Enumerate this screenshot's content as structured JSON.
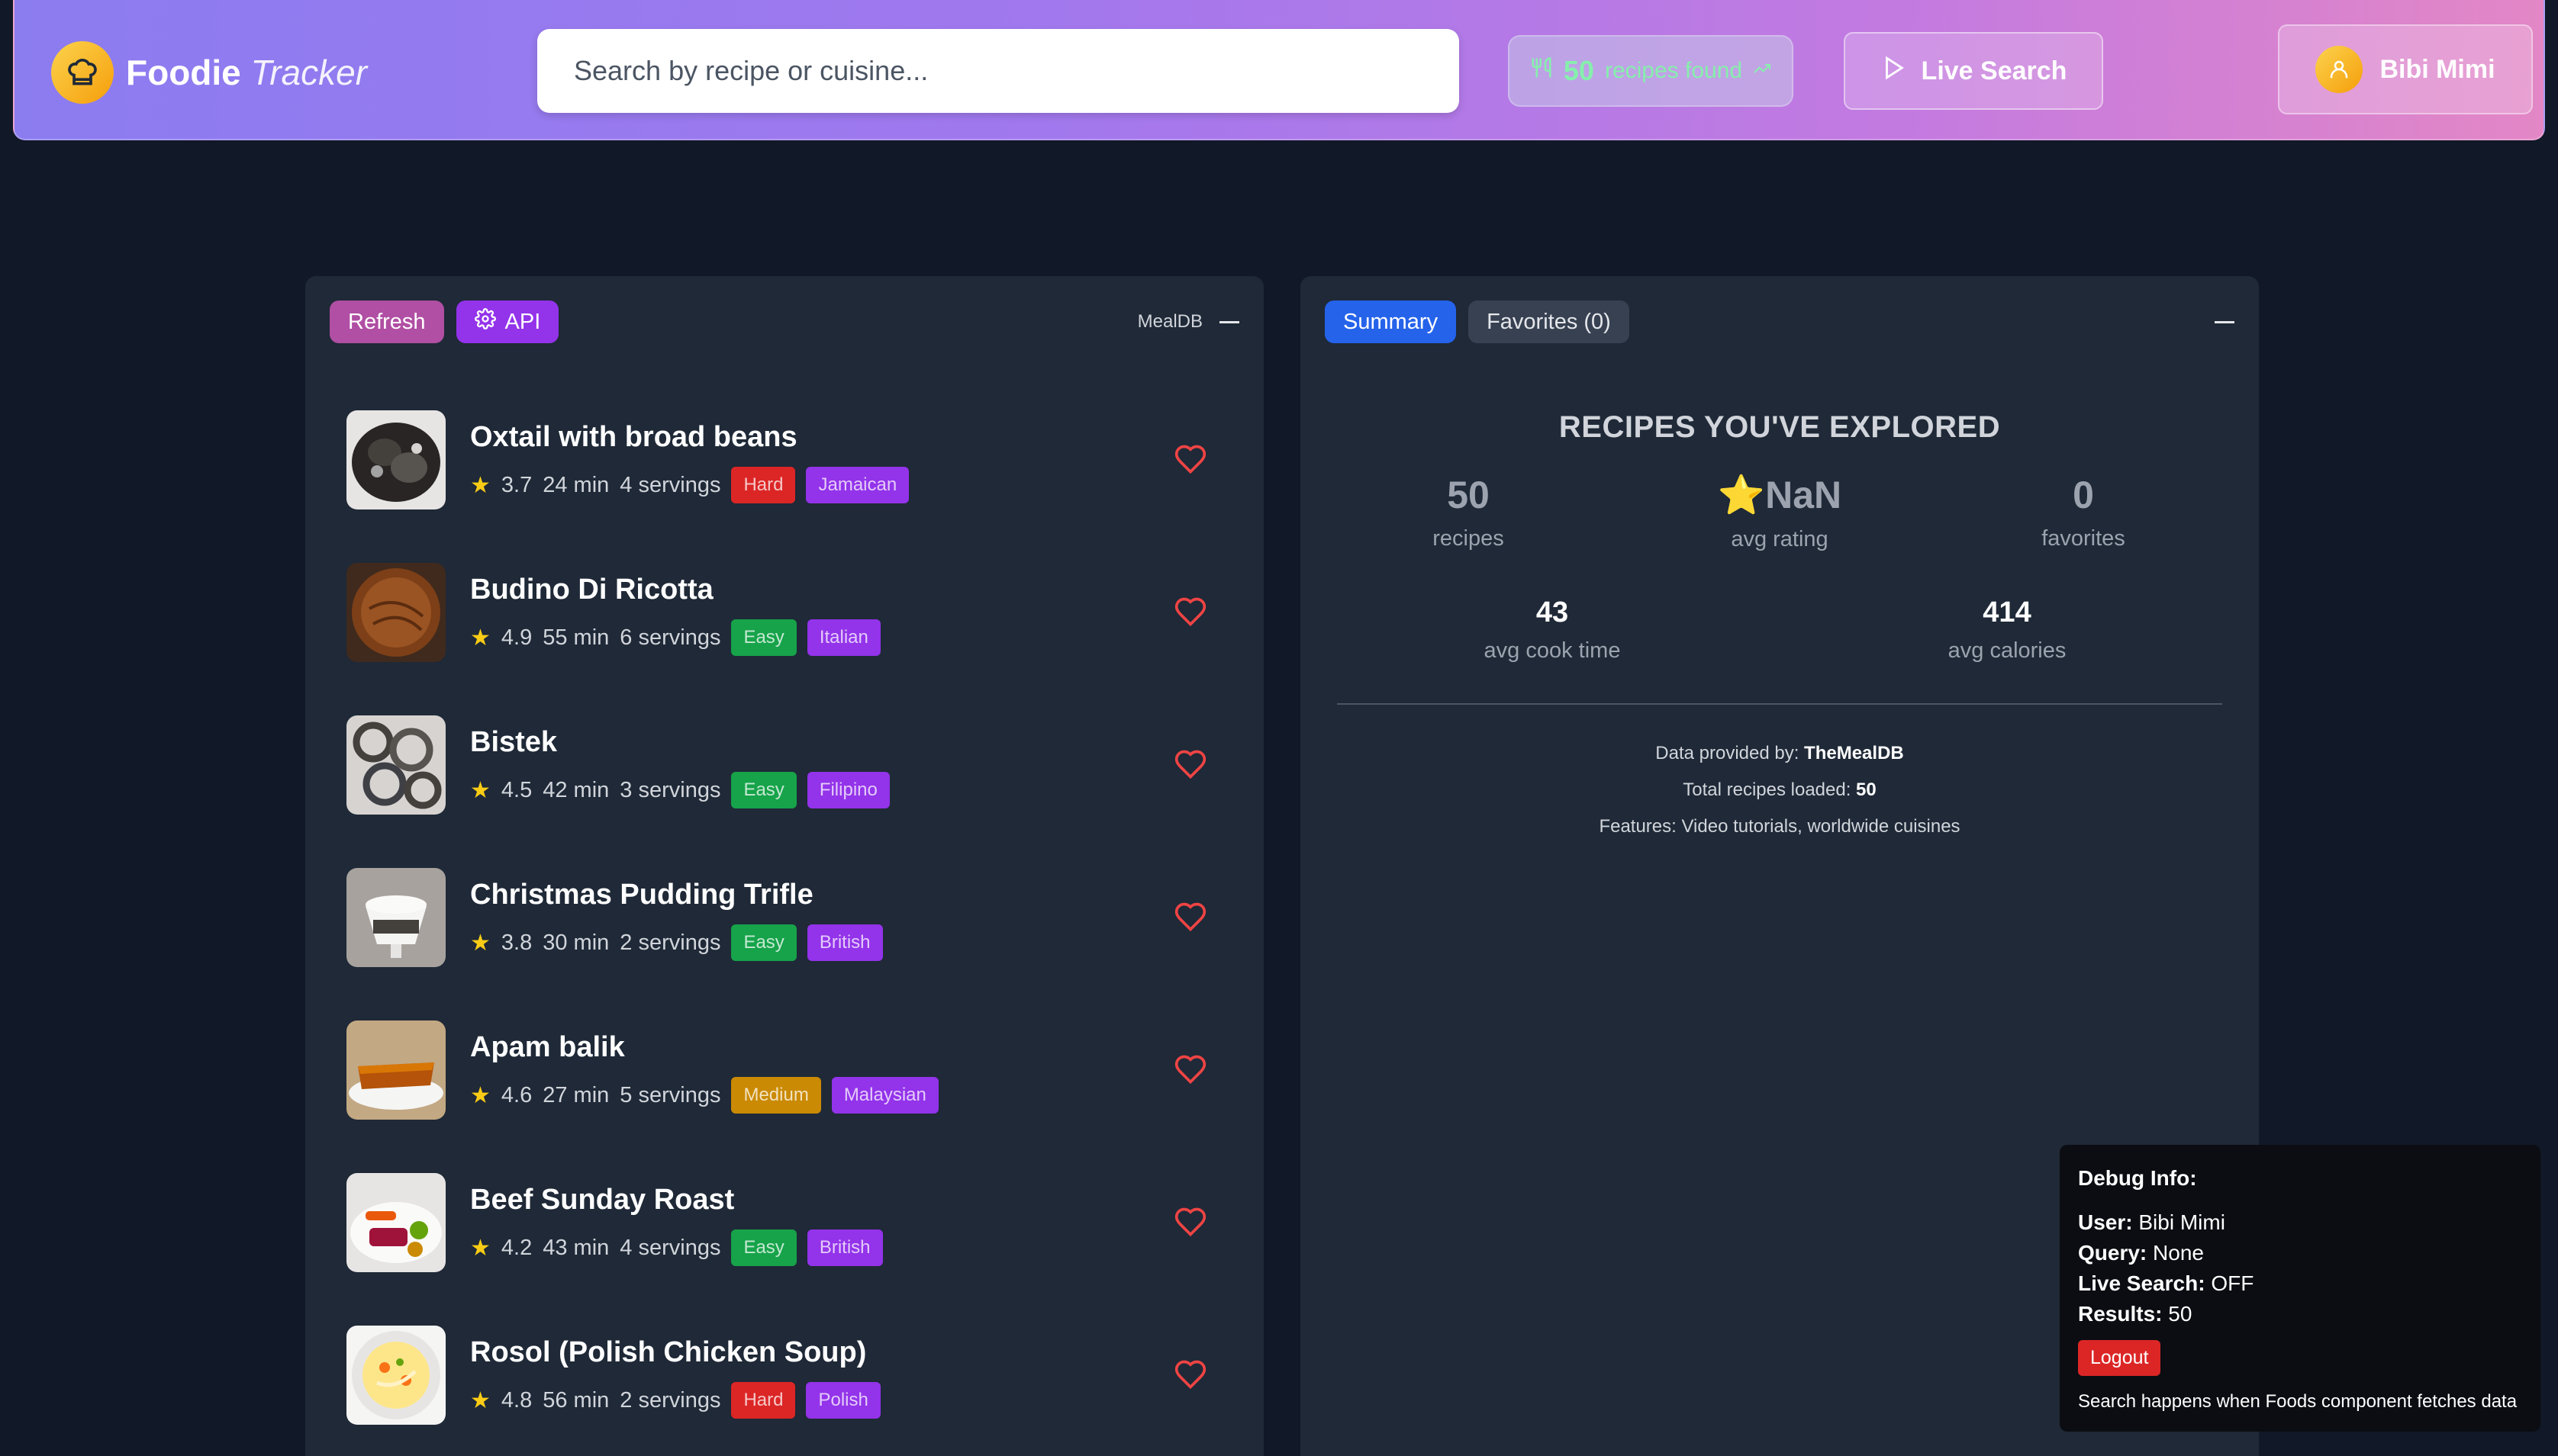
{
  "app": {
    "title_main": "Foodie",
    "title_accent": "Tracker",
    "logo_icon": "chef-hat-icon"
  },
  "search": {
    "placeholder": "Search by recipe or cuisine...",
    "value": ""
  },
  "found_badge": {
    "count": "50",
    "label": "recipes found",
    "icon": "utensils-icon"
  },
  "live_search": {
    "label": "Live Search",
    "icon": "play-icon"
  },
  "user": {
    "name": "Bibi Mimi",
    "icon": "user-icon"
  },
  "left_panel": {
    "refresh_label": "Refresh",
    "api_label": "API",
    "source_label": "MealDB"
  },
  "recipes": [
    {
      "name": "Oxtail with broad beans",
      "rating": "3.7",
      "time": "24 min",
      "servings": "4 servings",
      "difficulty": "Hard",
      "cuisine": "Jamaican"
    },
    {
      "name": "Budino Di Ricotta",
      "rating": "4.9",
      "time": "55 min",
      "servings": "6 servings",
      "difficulty": "Easy",
      "cuisine": "Italian"
    },
    {
      "name": "Bistek",
      "rating": "4.5",
      "time": "42 min",
      "servings": "3 servings",
      "difficulty": "Easy",
      "cuisine": "Filipino"
    },
    {
      "name": "Christmas Pudding Trifle",
      "rating": "3.8",
      "time": "30 min",
      "servings": "2 servings",
      "difficulty": "Easy",
      "cuisine": "British"
    },
    {
      "name": "Apam balik",
      "rating": "4.6",
      "time": "27 min",
      "servings": "5 servings",
      "difficulty": "Medium",
      "cuisine": "Malaysian"
    },
    {
      "name": "Beef Sunday Roast",
      "rating": "4.2",
      "time": "43 min",
      "servings": "4 servings",
      "difficulty": "Easy",
      "cuisine": "British"
    },
    {
      "name": "Rosol (Polish Chicken Soup)",
      "rating": "4.8",
      "time": "56 min",
      "servings": "2 servings",
      "difficulty": "Hard",
      "cuisine": "Polish"
    }
  ],
  "difficulty_colors": {
    "Hard": "#dc2626",
    "Easy": "#16a34a",
    "Medium": "#ca8a04"
  },
  "cuisine_color": "#9333ea",
  "right_panel": {
    "tab_summary": "Summary",
    "tab_favorites": "Favorites (0)",
    "heading": "RECIPES YOU'VE EXPLORED",
    "stats": {
      "recipes_value": "50",
      "recipes_label": "recipes",
      "rating_value": "⭐NaN",
      "rating_label": "avg rating",
      "favorites_value": "0",
      "favorites_label": "favorites",
      "cook_value": "43",
      "cook_label": "avg cook time",
      "calories_value": "414",
      "calories_label": "avg calories"
    },
    "credit_prefix": "Data provided by:",
    "credit_source": "TheMealDB",
    "total_prefix": "Total recipes loaded:",
    "total_value": "50",
    "features": "Features: Video tutorials, worldwide cuisines"
  },
  "debug": {
    "heading": "Debug Info:",
    "user_label": "User:",
    "user_value": "Bibi Mimi",
    "query_label": "Query:",
    "query_value": "None",
    "live_label": "Live Search:",
    "live_value": "OFF",
    "results_label": "Results:",
    "results_value": "50",
    "logout_label": "Logout",
    "note": "Search happens when Foods component fetches data"
  }
}
